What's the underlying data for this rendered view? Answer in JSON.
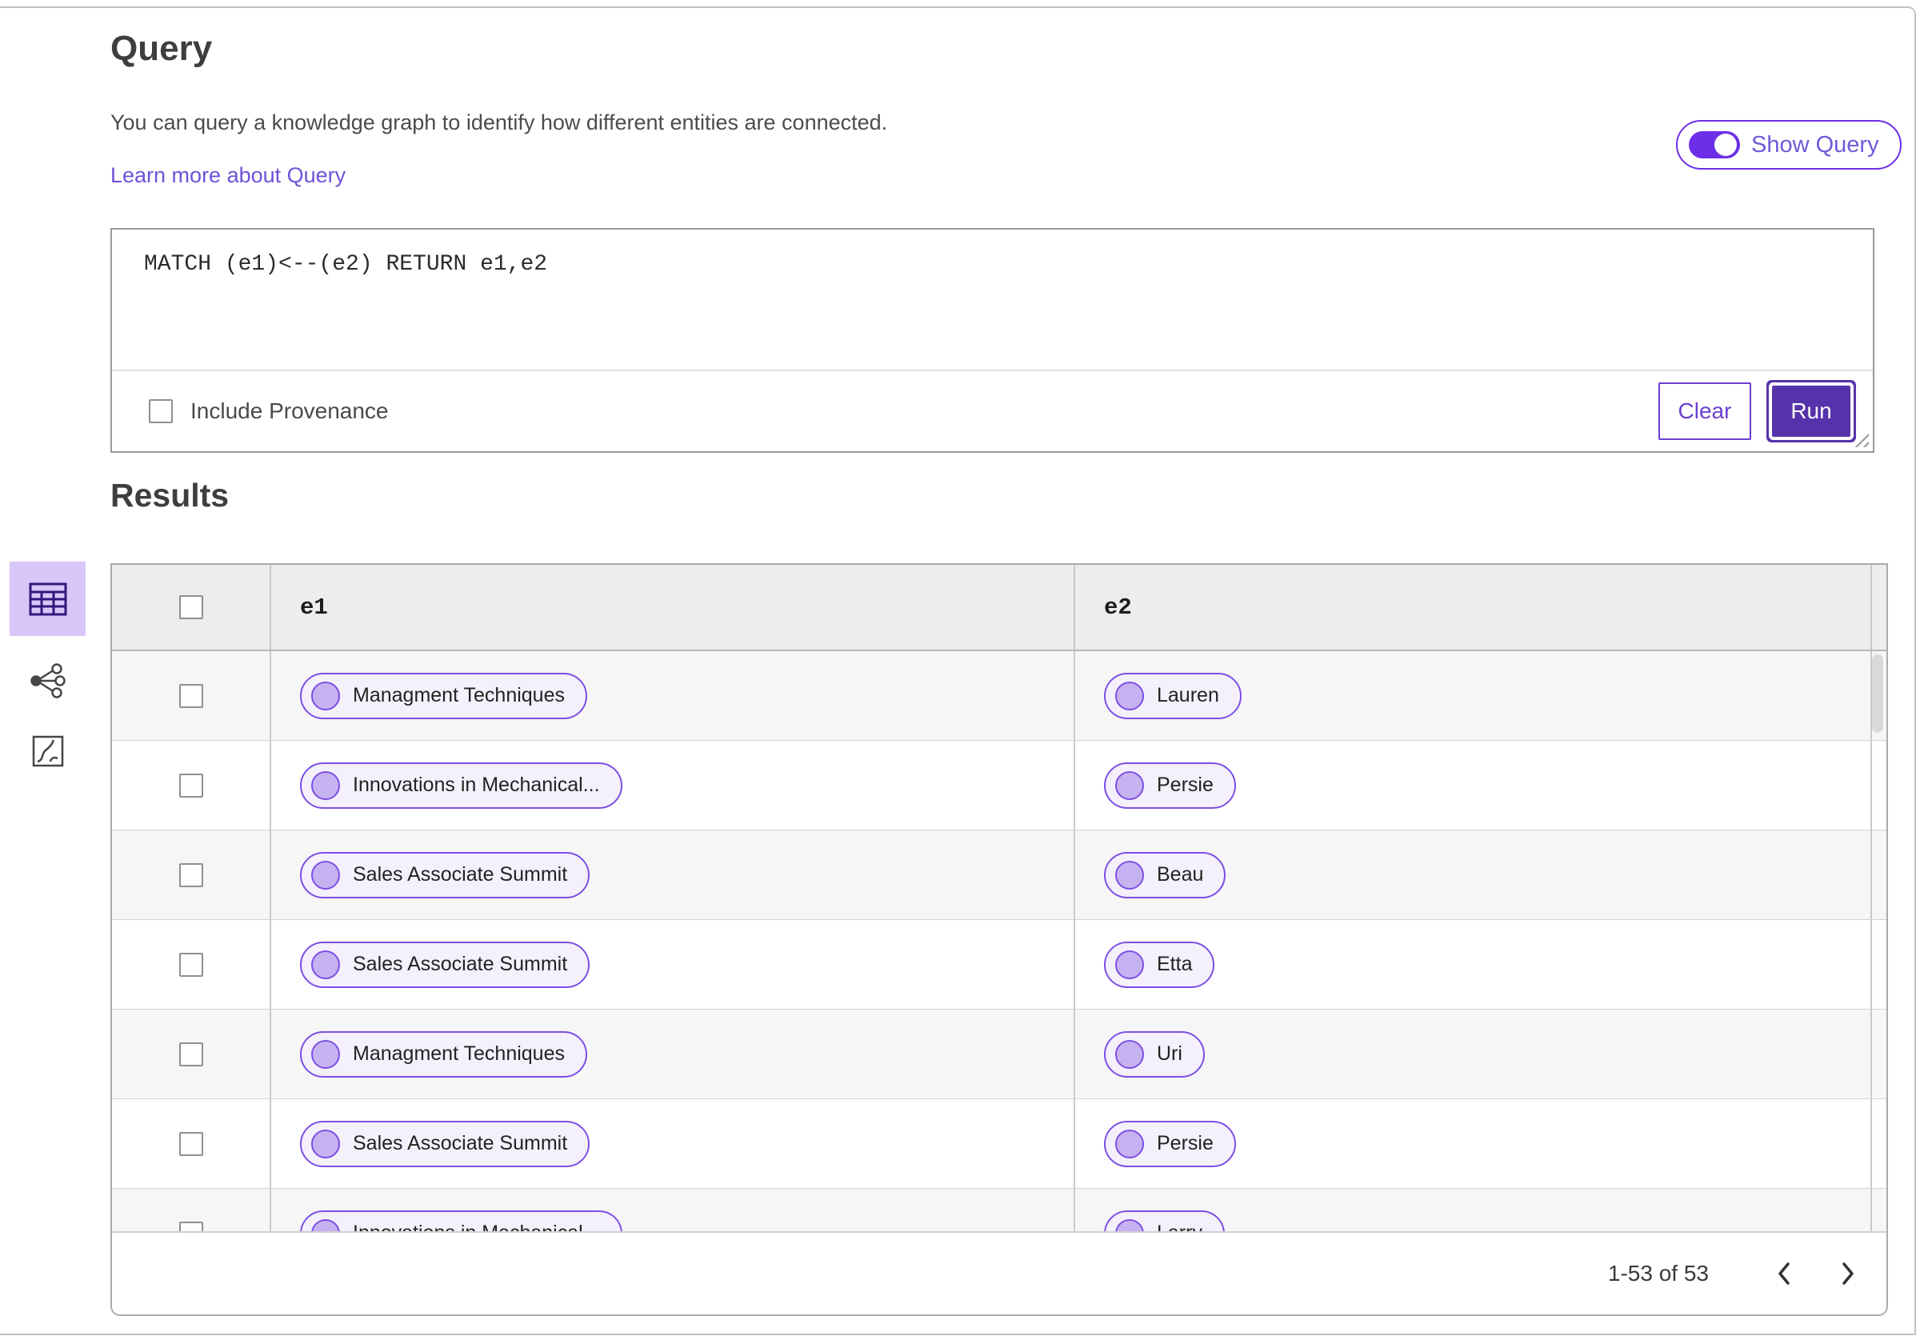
{
  "header": {
    "title": "Query",
    "description": "You can query a knowledge graph to identify how different entities are connected.",
    "learn_more_link": "Learn more about Query",
    "show_query_toggle": {
      "label": "Show Query",
      "state": "on"
    }
  },
  "query_editor": {
    "query_text": "MATCH (e1)<--(e2) RETURN e1,e2",
    "include_provenance": {
      "label": "Include Provenance",
      "checked": false
    },
    "buttons": {
      "clear": "Clear",
      "run": "Run"
    }
  },
  "results": {
    "heading": "Results",
    "view_switcher": [
      {
        "name": "table-view",
        "selected": true
      },
      {
        "name": "graph-view",
        "selected": false
      },
      {
        "name": "diagram-view",
        "selected": false
      }
    ],
    "table": {
      "columns": [
        "e1",
        "e2"
      ],
      "select_all_checked": false,
      "rows": [
        {
          "selected": false,
          "e1": "Managment Techniques",
          "e2": "Lauren"
        },
        {
          "selected": false,
          "e1": "Innovations in Mechanical...",
          "e2": "Persie"
        },
        {
          "selected": false,
          "e1": "Sales Associate Summit",
          "e2": "Beau"
        },
        {
          "selected": false,
          "e1": "Sales Associate Summit",
          "e2": "Etta"
        },
        {
          "selected": false,
          "e1": "Managment Techniques",
          "e2": "Uri"
        },
        {
          "selected": false,
          "e1": "Sales Associate Summit",
          "e2": "Persie"
        },
        {
          "selected": false,
          "e1": "Innovations in Mechanical...",
          "e2": "Larry"
        }
      ]
    },
    "pagination": {
      "range_text": "1-53 of 53"
    }
  },
  "colors": {
    "accent_purple": "#5733ab",
    "bright_purple": "#6d2ee8",
    "outline_button_purple": "#6b3fd1",
    "pill_border": "#7e4fe3",
    "pill_bg": "#f4f0fc",
    "pill_dot_fill": "#c7b2f1",
    "selected_view_bg": "#d9c6f8",
    "link": "#6f52d8",
    "row_stripe": "#f6f6f6",
    "table_header_bg": "#ededed"
  }
}
